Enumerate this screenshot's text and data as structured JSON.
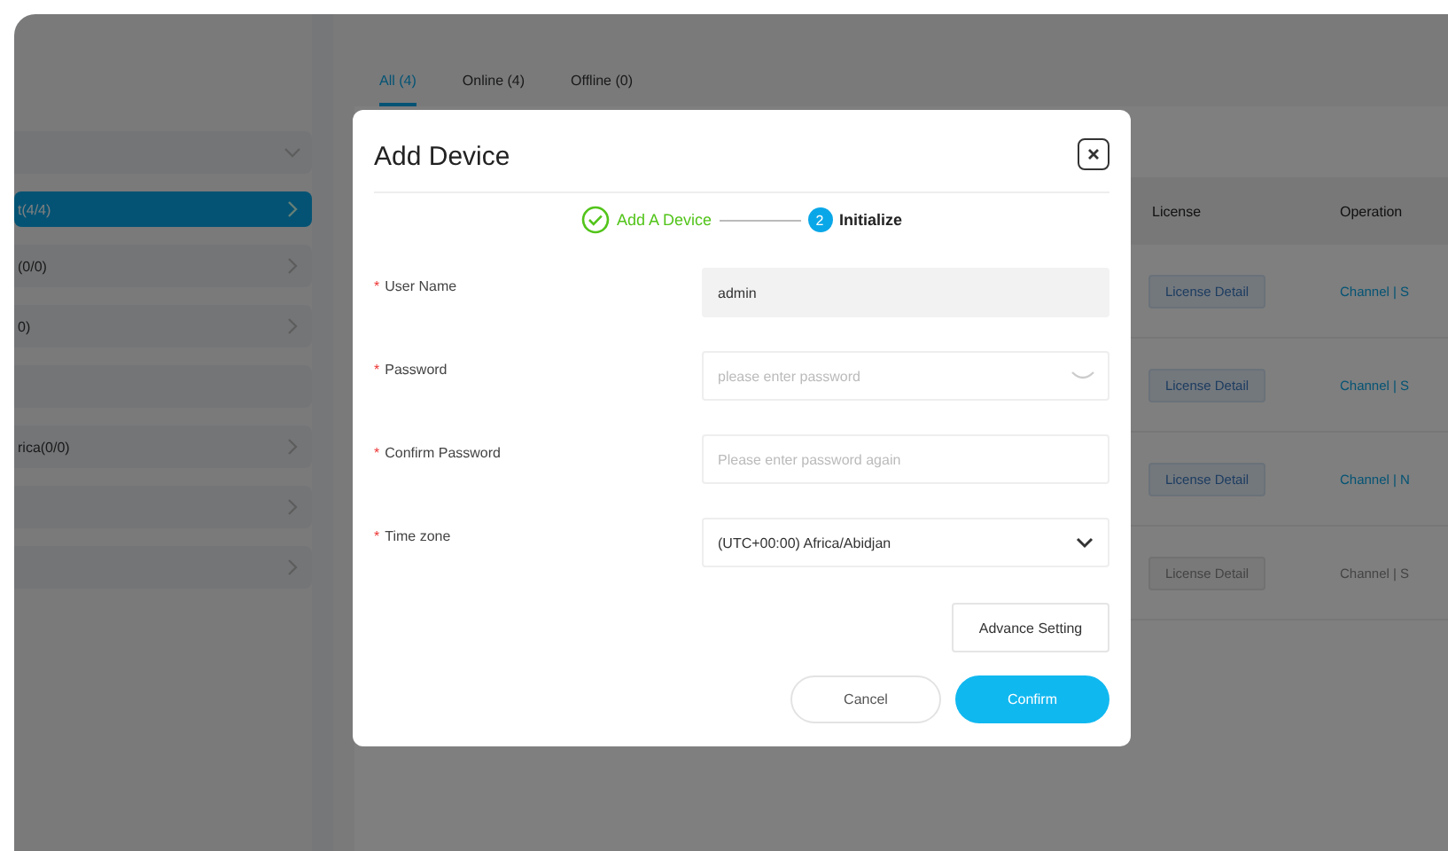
{
  "sidebar": {
    "items": [
      {
        "kind": "group",
        "selected": false
      },
      {
        "kind": "item",
        "label": "t(4/4)",
        "selected": true
      },
      {
        "kind": "item",
        "label": "(0/0)",
        "selected": false
      },
      {
        "kind": "item",
        "label": "0)",
        "selected": false
      },
      {
        "kind": "plain",
        "selected": false
      },
      {
        "kind": "item",
        "label": "rica(0/0)",
        "selected": false
      },
      {
        "kind": "item",
        "selected": false
      },
      {
        "kind": "item",
        "selected": false
      }
    ]
  },
  "tabs": [
    {
      "label": "All (4)",
      "selected": true
    },
    {
      "label": "Online (4)",
      "selected": false
    },
    {
      "label": "Offline (0)",
      "selected": false
    }
  ],
  "table": {
    "columns": [
      "License",
      "Operation"
    ],
    "rows": [
      {
        "license": "License Detail",
        "operation": "Channel | S",
        "disabled": false
      },
      {
        "license": "License Detail",
        "operation": "Channel | S",
        "disabled": false
      },
      {
        "license": "License Detail",
        "operation": "Channel | N",
        "disabled": false
      },
      {
        "license": "License Detail",
        "operation": "Channel | S",
        "disabled": true
      }
    ]
  },
  "dialog": {
    "title": "Add Device",
    "steps": [
      {
        "label": "Add A Device",
        "done": true
      },
      {
        "label": "Initialize",
        "done": false,
        "number": "2"
      }
    ],
    "fields": [
      {
        "label": "User Name",
        "required_mark": "*",
        "kind": "text",
        "value": "admin",
        "disabled": true
      },
      {
        "label": "Password",
        "required_mark": "*",
        "kind": "password",
        "placeholder": "please enter password",
        "disabled": false
      },
      {
        "label": "Confirm Password",
        "required_mark": "*",
        "kind": "text",
        "placeholder": "Please enter password again",
        "disabled": false
      },
      {
        "label": "Time zone",
        "required_mark": "*",
        "kind": "select",
        "value": "(UTC+00:00) Africa/Abidjan",
        "disabled": false
      }
    ],
    "advance_button": "Advance Setting",
    "cancel_button": "Cancel",
    "confirm_button": "Confirm"
  }
}
